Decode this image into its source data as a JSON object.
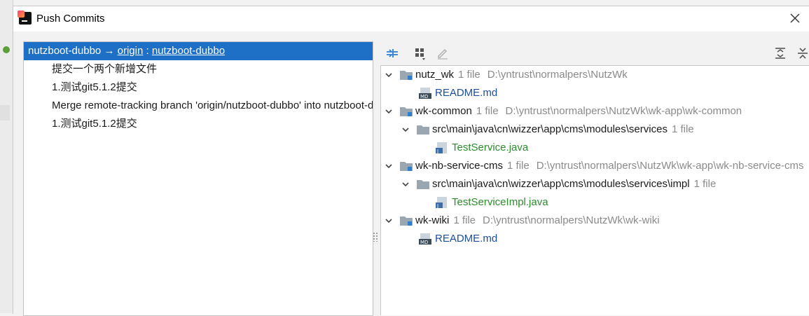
{
  "window": {
    "title": "Push Commits"
  },
  "commits": {
    "header": {
      "branch": "nutzboot-dubbo",
      "arrow": "→",
      "remote": "origin",
      "separator": ":",
      "remote_branch": "nutzboot-dubbo"
    },
    "items": [
      "提交一个两个新增文件",
      "1.测试git5.1.2提交",
      "Merge remote-tracking branch 'origin/nutzboot-dubbo' into nutzboot-dubbo",
      "1.测试git5.1.2提交"
    ]
  },
  "tree": {
    "nutz_wk": {
      "name": "nutz_wk",
      "count": "1 file",
      "path": "D:\\yntrust\\normalpers\\NutzWk"
    },
    "nutz_wk_file": "README.md",
    "wk_common": {
      "name": "wk-common",
      "count": "1 file",
      "path": "D:\\yntrust\\normalpers\\NutzWk\\wk-app\\wk-common"
    },
    "wk_common_dir": {
      "name": "src\\main\\java\\cn\\wizzer\\app\\cms\\modules\\services",
      "count": "1 file"
    },
    "wk_common_file": "TestService.java",
    "wk_nb": {
      "name": "wk-nb-service-cms",
      "count": "1 file",
      "path": "D:\\yntrust\\normalpers\\NutzWk\\wk-app\\wk-nb-service-cms"
    },
    "wk_nb_dir": {
      "name": "src\\main\\java\\cn\\wizzer\\app\\cms\\modules\\services\\impl",
      "count": "1 file"
    },
    "wk_nb_file": "TestServiceImpl.java",
    "wk_wiki": {
      "name": "wk-wiki",
      "count": "1 file",
      "path": "D:\\yntrust\\normalpers\\NutzWk\\wk-wiki"
    },
    "wk_wiki_file": "README.md"
  },
  "icons": {
    "close": "close-icon",
    "folder": "folder-icon",
    "module": "module-folder-icon",
    "markdown": "markdown-file-icon",
    "java": "java-file-icon",
    "toolbar": [
      "compare-icon",
      "group-by-icon",
      "edit-icon",
      "expand-all-icon",
      "collapse-all-icon"
    ]
  },
  "colors": {
    "selection": "#1e6fc6",
    "java_file": "#2e8b2e",
    "md_file": "#1a4fa0",
    "meta_text": "#8a8a8a"
  }
}
